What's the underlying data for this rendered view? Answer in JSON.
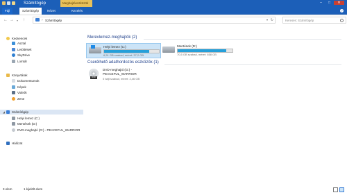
{
  "window": {
    "title": "Számítógép",
    "context_tab_header": "Meghajtóeszközök",
    "buttons": {
      "minimize": "–",
      "maximize": "□",
      "close": "✕"
    }
  },
  "ribbon": {
    "tabs": [
      {
        "label": "Fájl"
      },
      {
        "label": "Számítógép"
      },
      {
        "label": "Nézet"
      },
      {
        "label": "Kezelés"
      }
    ],
    "help": "?"
  },
  "address": {
    "path": "Számítógép",
    "search_placeholder": "Keresés: Számítógép"
  },
  "nav_pane": {
    "favorites_header": "Kedvencek",
    "favorites": [
      "Asztal",
      "Letöltések",
      "SkyDrive",
      "Lomtár"
    ],
    "libraries_header": "Könyvtárak",
    "libraries": [
      "Dokumentumok",
      "Képek",
      "Videók",
      "Zene"
    ],
    "computer_header": "Számítógép",
    "computer": [
      "Helyi lemez (C:)",
      "Mentések (D:)",
      "DVD-meghajtó (G:) - PEACEFUL_WARRIOR"
    ],
    "network_header": "Hálózat"
  },
  "content": {
    "group1": "Merevlemez-meghajtók (2)",
    "drives": [
      {
        "name": "Helyi lemez (C:)",
        "space": "6,51 GB szabad, méret: 37,2 GB",
        "used_fraction": 0.82
      },
      {
        "name": "Mentések (D:)",
        "space": "70,5 GB szabad, méret: 658 GB",
        "used_fraction": 0.89
      }
    ],
    "group2": "Cserélhető adathordozós eszközök (1)",
    "dvd": {
      "name_line1": "DVD-meghajtó (G:) -",
      "name_line2": "PEACEFUL_WARRIOR",
      "space": "0 bájt szabad, méret: 2,46 GB",
      "disc_label": "DVD"
    }
  },
  "status": {
    "items": "3 elem",
    "selected": "1 kijelölt elem"
  },
  "colors": {
    "accent": "#1c5fb8",
    "selection": "#cce4f7",
    "bar_fill": "#26a0da"
  }
}
